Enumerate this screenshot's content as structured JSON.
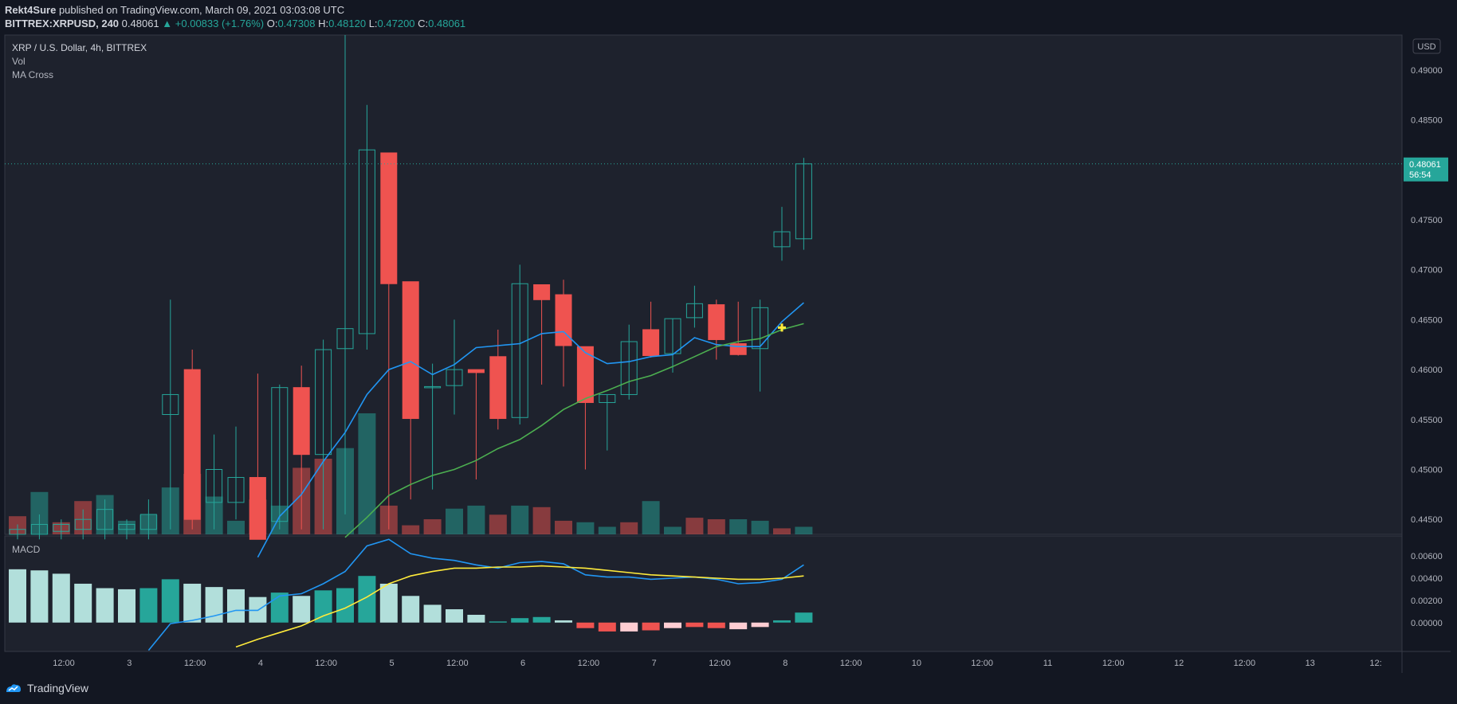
{
  "header": {
    "author": "Rekt4Sure",
    "published_text": "published on TradingView.com, March 09, 2021 03:03:08 UTC",
    "symbol": "BITTREX:XRPUSD, 240",
    "last": "0.48061",
    "change": "▲ +0.00833 (+1.76%)",
    "o_label": "O:",
    "o_value": "0.47308",
    "h_label": "H:",
    "h_value": "0.48120",
    "l_label": "L:",
    "l_value": "0.47200",
    "c_label": "C:",
    "c_value": "0.48061"
  },
  "legend": {
    "title": "XRP / U.S. Dollar, 4h, BITTREX",
    "vol": "Vol",
    "ma_cross": "MA Cross",
    "macd": "MACD"
  },
  "price_axis": {
    "currency_label": "USD",
    "last_price_tag": "0.48061",
    "countdown_tag": "56:54"
  },
  "footer": {
    "brand": "TradingView"
  },
  "colors": {
    "background": "#131722",
    "up": "#26a69a",
    "down": "#ef5350",
    "ma_fast": "#2196f3",
    "ma_slow": "#4caf50",
    "signal": "#ffeb3b",
    "hist_up_strong": "#26a69a",
    "hist_up_weak": "#b2dfdb",
    "hist_down_strong": "#ef5350",
    "hist_down_weak": "#ffcdd2"
  },
  "chart_data": [
    {
      "type": "candlestick",
      "title": "XRP / U.S. Dollar, 4h, BITTREX",
      "ylim": [
        0.4435,
        0.4935
      ],
      "y_ticks": [
        "0.44500",
        "0.45000",
        "0.45500",
        "0.46000",
        "0.46500",
        "0.47000",
        "0.47500",
        "0.48000",
        "0.48500",
        "0.49000"
      ],
      "x_ticks": [
        "12:00",
        "3",
        "12:00",
        "4",
        "12:00",
        "5",
        "12:00",
        "6",
        "12:00",
        "7",
        "12:00",
        "8",
        "12:00",
        "10",
        "12:00",
        "11",
        "12:00",
        "12",
        "12:00",
        "13",
        "12:"
      ],
      "candles": [
        {
          "o": 0.4435,
          "h": 0.4445,
          "l": 0.443,
          "c": 0.444
        },
        {
          "o": 0.4435,
          "h": 0.4455,
          "l": 0.443,
          "c": 0.4445
        },
        {
          "o": 0.4438,
          "h": 0.445,
          "l": 0.443,
          "c": 0.4445
        },
        {
          "o": 0.444,
          "h": 0.446,
          "l": 0.443,
          "c": 0.445
        },
        {
          "o": 0.444,
          "h": 0.447,
          "l": 0.443,
          "c": 0.446
        },
        {
          "o": 0.444,
          "h": 0.445,
          "l": 0.443,
          "c": 0.4445
        },
        {
          "o": 0.444,
          "h": 0.447,
          "l": 0.443,
          "c": 0.4455
        },
        {
          "o": 0.4555,
          "h": 0.467,
          "l": 0.444,
          "c": 0.4575
        },
        {
          "o": 0.46,
          "h": 0.462,
          "l": 0.444,
          "c": 0.445
        },
        {
          "o": 0.4467,
          "h": 0.4535,
          "l": 0.444,
          "c": 0.45
        },
        {
          "o": 0.4467,
          "h": 0.4543,
          "l": 0.445,
          "c": 0.4492
        },
        {
          "o": 0.4492,
          "h": 0.4596,
          "l": 0.443,
          "c": 0.443
        },
        {
          "o": 0.4448,
          "h": 0.4585,
          "l": 0.444,
          "c": 0.4582
        },
        {
          "o": 0.4582,
          "h": 0.4604,
          "l": 0.444,
          "c": 0.4515
        },
        {
          "o": 0.4515,
          "h": 0.463,
          "l": 0.444,
          "c": 0.462
        },
        {
          "o": 0.4621,
          "h": 0.4935,
          "l": 0.4455,
          "c": 0.4641
        },
        {
          "o": 0.4636,
          "h": 0.4865,
          "l": 0.462,
          "c": 0.482
        },
        {
          "o": 0.4817,
          "h": 0.4817,
          "l": 0.444,
          "c": 0.4686
        },
        {
          "o": 0.4688,
          "h": 0.4688,
          "l": 0.447,
          "c": 0.4551
        },
        {
          "o": 0.4582,
          "h": 0.4606,
          "l": 0.448,
          "c": 0.4583
        },
        {
          "o": 0.4584,
          "h": 0.465,
          "l": 0.4555,
          "c": 0.46
        },
        {
          "o": 0.46,
          "h": 0.46,
          "l": 0.449,
          "c": 0.4597
        },
        {
          "o": 0.4613,
          "h": 0.464,
          "l": 0.454,
          "c": 0.4551
        },
        {
          "o": 0.4552,
          "h": 0.4705,
          "l": 0.4545,
          "c": 0.4686
        },
        {
          "o": 0.4685,
          "h": 0.4685,
          "l": 0.4585,
          "c": 0.467
        },
        {
          "o": 0.4675,
          "h": 0.469,
          "l": 0.4583,
          "c": 0.4624
        },
        {
          "o": 0.4623,
          "h": 0.4623,
          "l": 0.45,
          "c": 0.4567
        },
        {
          "o": 0.4567,
          "h": 0.4575,
          "l": 0.4519,
          "c": 0.4575
        },
        {
          "o": 0.4575,
          "h": 0.4645,
          "l": 0.457,
          "c": 0.4628
        },
        {
          "o": 0.464,
          "h": 0.4668,
          "l": 0.4612,
          "c": 0.4614
        },
        {
          "o": 0.4616,
          "h": 0.4651,
          "l": 0.4597,
          "c": 0.4651
        },
        {
          "o": 0.4652,
          "h": 0.4684,
          "l": 0.4642,
          "c": 0.4666
        },
        {
          "o": 0.4665,
          "h": 0.467,
          "l": 0.461,
          "c": 0.463
        },
        {
          "o": 0.4626,
          "h": 0.4668,
          "l": 0.4614,
          "c": 0.4615
        },
        {
          "o": 0.4621,
          "h": 0.467,
          "l": 0.4578,
          "c": 0.4662
        },
        {
          "o": 0.4723,
          "h": 0.4763,
          "l": 0.4709,
          "c": 0.4738
        },
        {
          "o": 0.4731,
          "h": 0.4812,
          "l": 0.472,
          "c": 0.4806
        }
      ],
      "series": [
        {
          "name": "MA fast",
          "values": [
            null,
            null,
            null,
            null,
            null,
            null,
            null,
            null,
            null,
            null,
            null,
            0.4412,
            0.4453,
            0.4475,
            0.4508,
            0.4537,
            0.4575,
            0.46,
            0.4608,
            0.4595,
            0.4605,
            0.4622,
            0.4624,
            0.4626,
            0.4636,
            0.4638,
            0.4617,
            0.4606,
            0.4608,
            0.4613,
            0.4615,
            0.4632,
            0.4625,
            0.4623,
            0.4623,
            0.4648,
            0.4667
          ]
        },
        {
          "name": "MA slow",
          "values": [
            null,
            null,
            null,
            null,
            null,
            null,
            null,
            null,
            null,
            null,
            null,
            null,
            null,
            null,
            null,
            0.4432,
            0.4452,
            0.4474,
            0.4485,
            0.4494,
            0.45,
            0.4509,
            0.4521,
            0.453,
            0.4544,
            0.456,
            0.4571,
            0.4579,
            0.4588,
            0.4594,
            0.4603,
            0.4613,
            0.4623,
            0.4628,
            0.4631,
            0.464,
            0.4646
          ]
        }
      ],
      "ma_cross_marker": {
        "index": 35,
        "value": 0.4642
      }
    },
    {
      "type": "bar",
      "title": "Vol",
      "values": [
        12,
        28,
        8,
        22,
        26,
        9,
        13,
        31,
        40,
        25,
        9,
        23,
        19,
        44,
        50,
        57,
        80,
        19,
        6,
        10,
        17,
        19,
        13,
        19,
        18,
        9,
        8,
        5,
        8,
        22,
        5,
        11,
        10,
        10,
        9,
        4,
        5
      ],
      "directions": [
        "down",
        "up",
        "down",
        "down",
        "up",
        "up",
        "up",
        "up",
        "down",
        "up",
        "up",
        "down",
        "up",
        "down",
        "down",
        "up",
        "up",
        "down",
        "down",
        "down",
        "up",
        "up",
        "down",
        "up",
        "down",
        "down",
        "up",
        "up",
        "down",
        "up",
        "up",
        "down",
        "down",
        "up",
        "up",
        "down",
        "up"
      ]
    },
    {
      "type": "bar",
      "title": "MACD",
      "ylim": [
        -0.0026,
        0.0078
      ],
      "y_ticks": [
        "0.00000",
        "0.00200",
        "0.00400",
        "0.00600"
      ],
      "histogram": [
        0.0048,
        0.0047,
        0.0044,
        0.0035,
        0.0031,
        0.003,
        0.0031,
        0.0039,
        0.0035,
        0.0032,
        0.003,
        0.0023,
        0.0027,
        0.0024,
        0.0029,
        0.0031,
        0.0042,
        0.0035,
        0.0024,
        0.0016,
        0.0012,
        0.0007,
        0.0001,
        0.0004,
        0.0005,
        0.0002,
        -0.0005,
        -0.0008,
        -0.0008,
        -0.0007,
        -0.0005,
        -0.0004,
        -0.0005,
        -0.0006,
        -0.0004,
        0.0002,
        0.0009
      ],
      "histogram_shades": [
        "weak",
        "weak",
        "weak",
        "weak",
        "weak",
        "weak",
        "strong",
        "strong",
        "weak",
        "weak",
        "weak",
        "weak",
        "strong",
        "weak",
        "strong",
        "strong",
        "strong",
        "weak",
        "weak",
        "weak",
        "weak",
        "weak",
        "strong",
        "strong",
        "strong",
        "weak",
        "strong",
        "strong",
        "weak",
        "strong",
        "weak",
        "strong",
        "strong",
        "weak",
        "weak",
        "strong",
        "strong"
      ],
      "series": [
        {
          "name": "MACD",
          "values": [
            null,
            null,
            null,
            null,
            null,
            null,
            -0.0025,
            -0.0001,
            0.0002,
            0.0006,
            0.0011,
            0.0011,
            0.0024,
            0.0026,
            0.0035,
            0.0046,
            0.0069,
            0.0075,
            0.0062,
            0.0058,
            0.0056,
            0.0052,
            0.0049,
            0.0054,
            0.0055,
            0.0053,
            0.0043,
            0.0041,
            0.0041,
            0.0039,
            0.004,
            0.0041,
            0.0039,
            0.0035,
            0.0036,
            0.0039,
            0.0052
          ]
        },
        {
          "name": "Signal",
          "values": [
            null,
            null,
            null,
            null,
            null,
            null,
            null,
            null,
            null,
            null,
            -0.0022,
            -0.0015,
            -0.0009,
            -0.0003,
            0.0006,
            0.0013,
            0.0023,
            0.0035,
            0.0042,
            0.0046,
            0.0049,
            0.0049,
            0.005,
            0.005,
            0.0051,
            0.005,
            0.0049,
            0.0047,
            0.0045,
            0.0043,
            0.0042,
            0.0041,
            0.004,
            0.0039,
            0.0039,
            0.004,
            0.0042
          ]
        }
      ]
    }
  ]
}
